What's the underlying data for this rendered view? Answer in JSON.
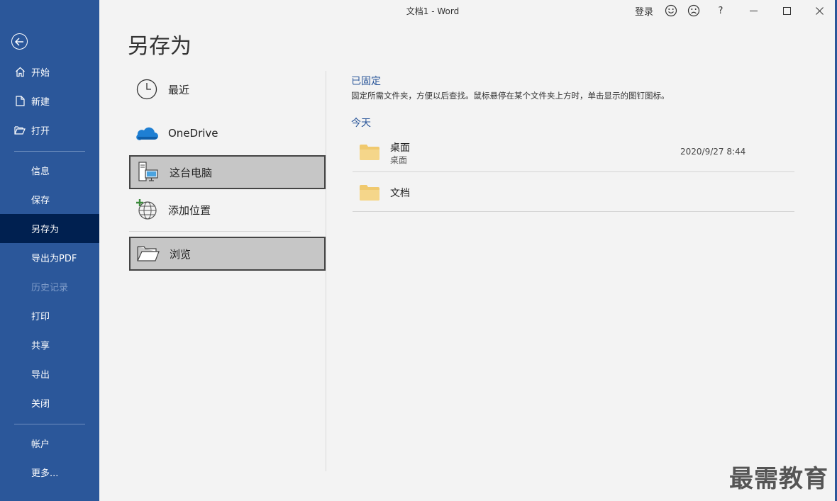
{
  "window": {
    "title": "文档1  -  Word",
    "login": "登录",
    "help": "?"
  },
  "sidebar": {
    "items": [
      {
        "label": "开始",
        "icon": "home-icon"
      },
      {
        "label": "新建",
        "icon": "new-document-icon"
      },
      {
        "label": "打开",
        "icon": "open-folder-icon"
      },
      {
        "label": "信息"
      },
      {
        "label": "保存"
      },
      {
        "label": "另存为",
        "active": true
      },
      {
        "label": "导出为PDF"
      },
      {
        "label": "历史记录",
        "disabled": true
      },
      {
        "label": "打印"
      },
      {
        "label": "共享"
      },
      {
        "label": "导出"
      },
      {
        "label": "关闭"
      },
      {
        "label": "帐户"
      },
      {
        "label": "更多..."
      }
    ]
  },
  "main": {
    "heading": "另存为",
    "locations": [
      {
        "label": "最近",
        "icon": "clock-icon"
      },
      {
        "label": "OneDrive",
        "icon": "cloud-icon"
      },
      {
        "label": "这台电脑",
        "icon": "computer-icon",
        "selected": true
      },
      {
        "label": "添加位置",
        "icon": "add-location-globe-icon"
      },
      {
        "label": "浏览",
        "icon": "browse-folder-icon",
        "selected": true
      }
    ],
    "pinned": {
      "title": "已固定",
      "description": "固定所需文件夹，方便以后查找。鼠标悬停在某个文件夹上方时，单击显示的图钉图标。"
    },
    "today": {
      "title": "今天",
      "folders": [
        {
          "name": "桌面",
          "path": "桌面",
          "date": "2020/9/27 8:44"
        },
        {
          "name": "文档",
          "path": "",
          "date": ""
        }
      ]
    }
  },
  "watermark": "最需教育",
  "colors": {
    "sidebar": "#2b579a",
    "sidebar_active": "#002050",
    "accent_text": "#2b579a",
    "folder": "#f0c96e"
  }
}
